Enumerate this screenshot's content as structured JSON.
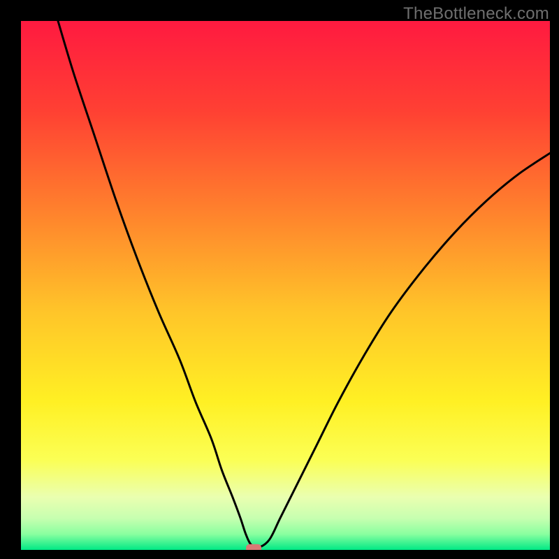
{
  "watermark": "TheBottleneck.com",
  "chart_data": {
    "type": "line",
    "title": "",
    "xlabel": "",
    "ylabel": "",
    "xlim": [
      0,
      100
    ],
    "ylim": [
      0,
      100
    ],
    "background": {
      "type": "vertical-gradient",
      "stops": [
        {
          "pos": 0.0,
          "color": "#ff1a40"
        },
        {
          "pos": 0.17,
          "color": "#ff4033"
        },
        {
          "pos": 0.35,
          "color": "#ff7e2d"
        },
        {
          "pos": 0.55,
          "color": "#ffc529"
        },
        {
          "pos": 0.72,
          "color": "#fff024"
        },
        {
          "pos": 0.83,
          "color": "#fbff55"
        },
        {
          "pos": 0.9,
          "color": "#eaffb0"
        },
        {
          "pos": 0.94,
          "color": "#c7ffb0"
        },
        {
          "pos": 0.97,
          "color": "#8affa0"
        },
        {
          "pos": 1.0,
          "color": "#00e985"
        }
      ]
    },
    "marker": {
      "x": 44.0,
      "y": 0.3,
      "color": "#d97a75",
      "shape": "rounded-rect"
    },
    "series": [
      {
        "name": "bottleneck-curve",
        "color": "#000000",
        "x": [
          7,
          10,
          14,
          18,
          22,
          26,
          30,
          33,
          36,
          38,
          40,
          41.5,
          42.5,
          43.5,
          45,
          47,
          49,
          52,
          56,
          60,
          65,
          70,
          76,
          82,
          88,
          94,
          100
        ],
        "y": [
          100,
          90,
          78,
          66,
          55,
          45,
          36,
          28,
          21,
          15,
          10,
          6,
          3,
          1,
          0.5,
          2,
          6,
          12,
          20,
          28,
          37,
          45,
          53,
          60,
          66,
          71,
          75
        ]
      }
    ]
  }
}
